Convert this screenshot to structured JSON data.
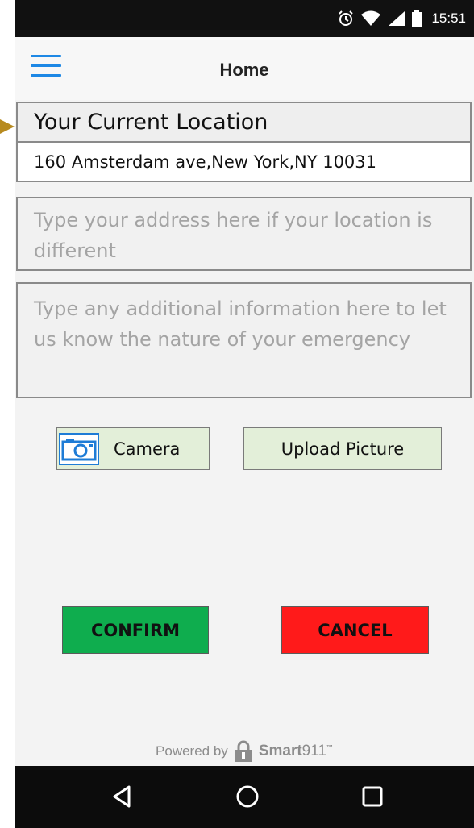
{
  "status_bar": {
    "time": "15:51",
    "icons": [
      "alarm-icon",
      "wifi-icon",
      "signal-icon",
      "battery-icon"
    ]
  },
  "app_bar": {
    "title": "Home",
    "menu_icon": "hamburger-menu-icon",
    "accent_color": "#1e88e5"
  },
  "location": {
    "title": "Your Current Location",
    "address": "160 Amsterdam ave,New York,NY 10031"
  },
  "address_field": {
    "placeholder": "Type your address here if your location is different",
    "value": ""
  },
  "info_field": {
    "placeholder": "Type any additional information here to let us know the nature of your emergency",
    "value": ""
  },
  "media_buttons": {
    "camera_label": "Camera",
    "camera_icon": "camera-icon",
    "upload_label": "Upload Picture",
    "background_color": "#e3efd9"
  },
  "actions": {
    "confirm_label": "CONFIRM",
    "confirm_color": "#0fad4e",
    "cancel_label": "CANCEL",
    "cancel_color": "#ff1a1a"
  },
  "footer": {
    "powered_by": "Powered by",
    "brand": "Smart911",
    "brand_bold": "Smart",
    "brand_light": "911"
  },
  "nav_bar": {
    "buttons": [
      "back-icon",
      "home-icon",
      "recents-icon"
    ]
  }
}
